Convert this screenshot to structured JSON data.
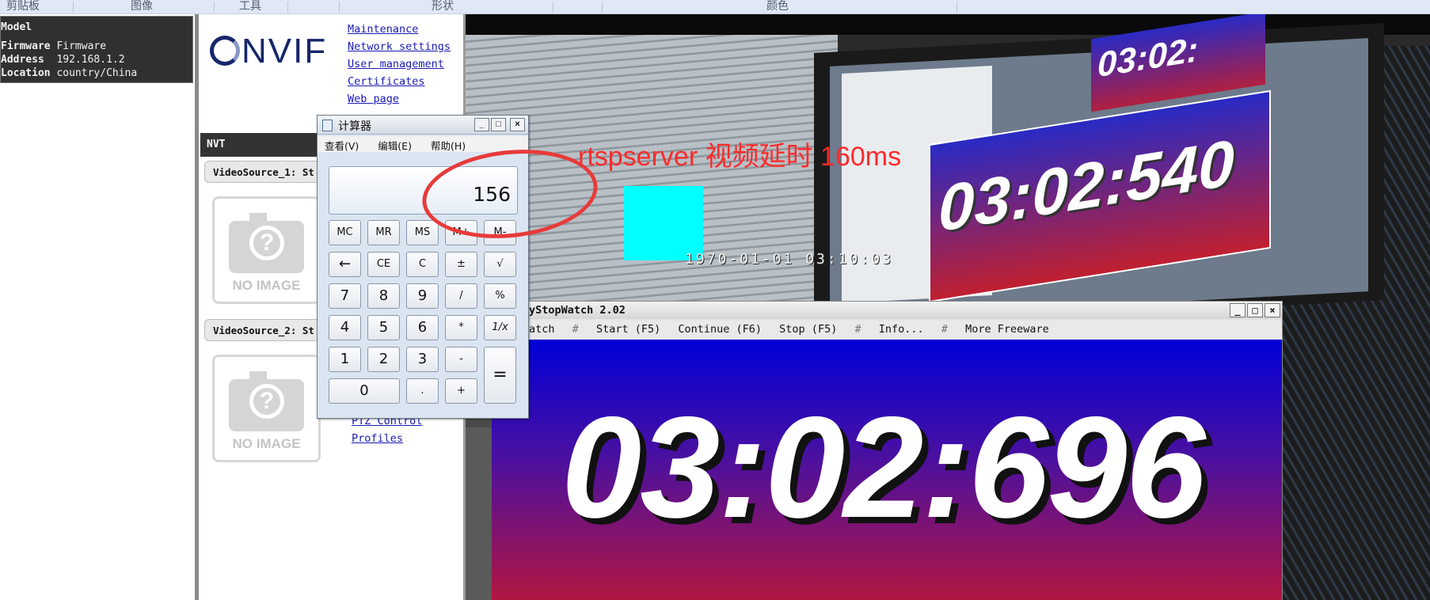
{
  "ribbon": {
    "groups": [
      "剪贴板",
      "图像",
      "工具",
      "形状",
      "颜色"
    ]
  },
  "device_info": {
    "title": "Model",
    "rows": [
      {
        "key": "Firmware",
        "value": "Firmware"
      },
      {
        "key": "Address",
        "value": "192.168.1.2"
      },
      {
        "key": "Location",
        "value": "country/China"
      }
    ]
  },
  "onvif": {
    "menu_top": [
      "Maintenance",
      "Network settings",
      "User management",
      "Certificates",
      "Web page"
    ],
    "nvt_label": "NVT",
    "video_sources": [
      "VideoSource_1: St",
      "VideoSource_2: St"
    ],
    "no_image_label": "NO IMAGE",
    "menu_bottom": [
      "PTZ Control",
      "Profiles"
    ],
    "brand_color": "#17266a"
  },
  "calculator": {
    "title": "计算器",
    "menu": [
      "查看(V)",
      "编辑(E)",
      "帮助(H)"
    ],
    "display_value": "156",
    "keys": [
      [
        "MC",
        "MR",
        "MS",
        "M+",
        "M-"
      ],
      [
        "←",
        "CE",
        "C",
        "±",
        "√"
      ],
      [
        "7",
        "8",
        "9",
        "/",
        "%"
      ],
      [
        "4",
        "5",
        "6",
        "*",
        "1/x"
      ],
      [
        "1",
        "2",
        "3",
        "-",
        "="
      ],
      [
        "0",
        ".",
        "+"
      ]
    ],
    "window_controls": [
      "_",
      "□",
      "×"
    ]
  },
  "video": {
    "annotation": "rtspserver 视频延时 160ms",
    "annotation_color": "#ff2a2a",
    "overlay_timestamp": "1970-01-01 03:10:03",
    "marker_color": "#00ffff",
    "captured_clock": "03:02:540",
    "captured_clock_small": "03:02:"
  },
  "stopwatch": {
    "title": "yStopWatch 2.02",
    "menu": [
      "atch",
      "#",
      "Start (F5)",
      "Continue (F6)",
      "Stop (F5)",
      "#",
      "Info...",
      "#",
      "More Freeware"
    ],
    "time": "03:02:696",
    "window_controls": [
      "_",
      "□",
      "×"
    ]
  }
}
